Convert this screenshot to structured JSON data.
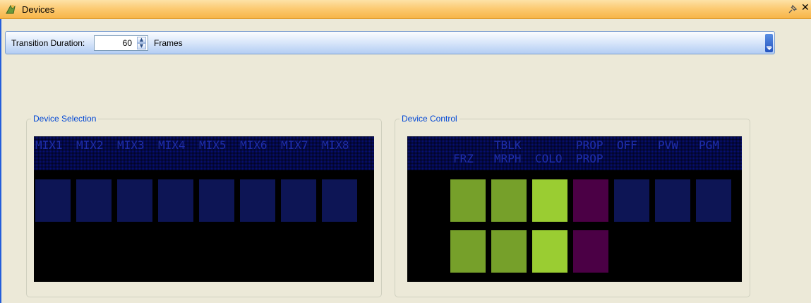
{
  "window": {
    "title": "Devices",
    "icon": "devices-icon"
  },
  "toolbar": {
    "duration_label": "Transition Duration:",
    "duration_value": "60",
    "frames_label": "Frames"
  },
  "device_selection": {
    "title": "Device Selection",
    "labels": [
      "MIX1",
      "MIX2",
      "MIX3",
      "MIX4",
      "MIX5",
      "MIX6",
      "MIX7",
      "MIX8"
    ]
  },
  "device_control": {
    "title": "Device Control",
    "labels_top": [
      "",
      "",
      "TBLK",
      "",
      "PROP",
      "OFF",
      "PVW",
      "PGM"
    ],
    "labels_bottom": [
      "",
      "FRZ",
      "MRPH",
      "COLO",
      "PROP",
      "",
      "",
      ""
    ],
    "row1_colors": [
      "#76a02a",
      "#76a02a",
      "#9acd32",
      "#4b0045",
      "#0d1555",
      "#0d1555",
      "#0d1555"
    ],
    "row2_colors": [
      "#76a02a",
      "#76a02a",
      "#9acd32",
      "#4b0045"
    ]
  },
  "colors": {
    "title_bar": "#fccb74",
    "group_title": "#0046d5",
    "lcd_text": "#1f2ea8",
    "lcd_band": "#060f74",
    "pad_dark": "#0d1555",
    "pad_green": "#76a02a",
    "pad_lightgreen": "#9acd32",
    "pad_purple": "#4b0045"
  }
}
